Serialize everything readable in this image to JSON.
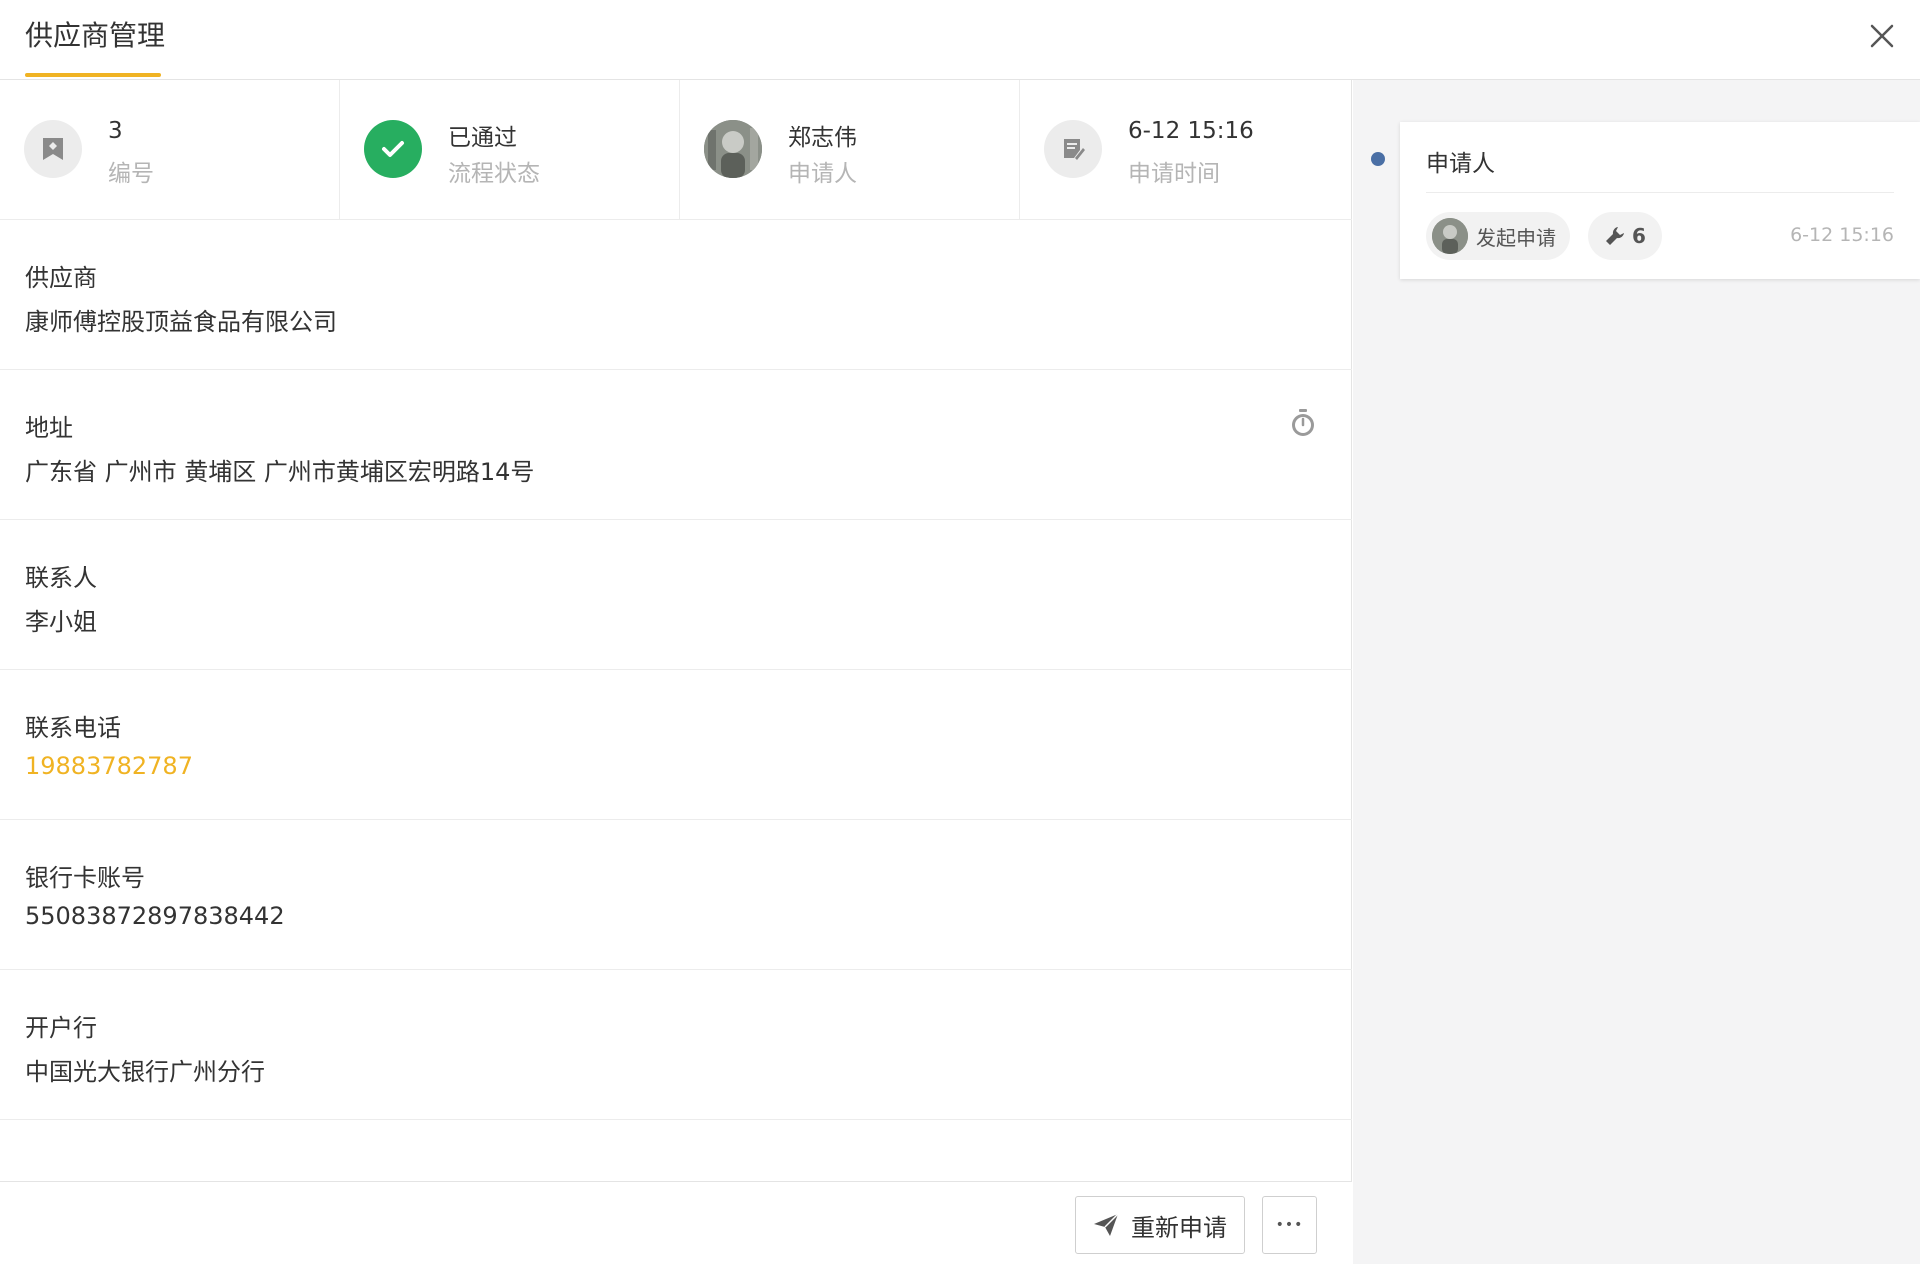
{
  "header": {
    "tab_label": "供应商管理"
  },
  "summary": {
    "number": {
      "value": "3",
      "label": "编号",
      "icon": "tag-icon"
    },
    "status": {
      "value": "已通过",
      "label": "流程状态",
      "icon": "check-icon",
      "color": "#27ae60"
    },
    "applicant": {
      "value": "郑志伟",
      "label": "申请人",
      "icon": "avatar"
    },
    "apply_time": {
      "value": "6-12 15:16",
      "label": "申请时间",
      "icon": "document-edit-icon"
    }
  },
  "fields": {
    "supplier": {
      "label": "供应商",
      "value": "康师傅控股顶益食品有限公司"
    },
    "address": {
      "label": "地址",
      "value": "广东省 广州市 黄埔区 广州市黄埔区宏明路14号"
    },
    "contact": {
      "label": "联系人",
      "value": "李小姐"
    },
    "phone": {
      "label": "联系电话",
      "value": "19883782787",
      "color": "#f0b323"
    },
    "bank_account": {
      "label": "银行卡账号",
      "value": "55083872897838442"
    },
    "bank_name": {
      "label": "开户行",
      "value": "中国光大银行广州分行"
    }
  },
  "footer": {
    "reapply_label": "重新申请",
    "more_label": "•••"
  },
  "timeline": {
    "items": [
      {
        "title": "申请人",
        "action": "发起申请",
        "tool_count": "6",
        "time": "6-12 15:16"
      }
    ]
  },
  "colors": {
    "accent": "#f0b323",
    "success": "#27ae60",
    "timeline_dot": "#4a6fa5"
  }
}
